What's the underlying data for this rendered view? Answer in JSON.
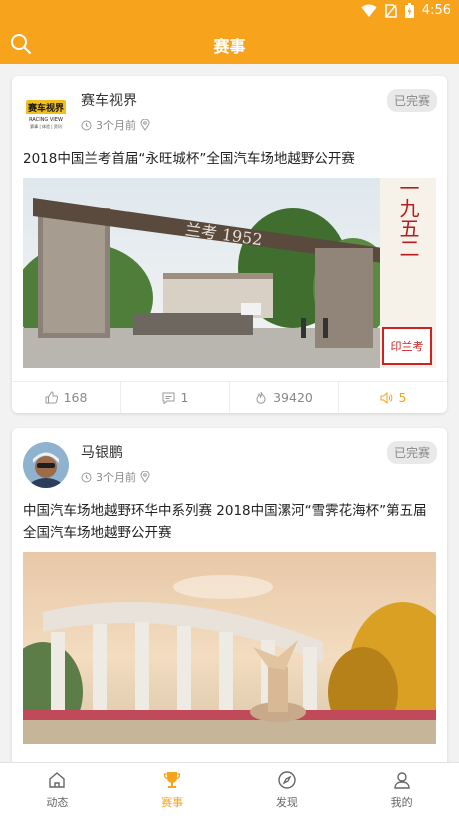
{
  "status_bar": {
    "time": "4:56"
  },
  "header": {
    "title": "赛事"
  },
  "theme": {
    "accent": "#f7a31c"
  },
  "feed": [
    {
      "author": "赛车视界",
      "avatar_text": "赛车视界",
      "avatar_sub": "RACING VIEW",
      "avatar_tag": "赛事 | 体验 | 资讯",
      "time": "3个月前",
      "status": "已完赛",
      "headline": "2018中国兰考首届“永旺城杯”全国汽车场地越野公开赛",
      "image_caption": "兰考 1952",
      "image_side": "蘭考一九五二",
      "image_seal": "印兰考",
      "stats": {
        "likes": "168",
        "comments": "1",
        "views": "39420",
        "shares": "5"
      }
    },
    {
      "author": "马银鹏",
      "time": "3个月前",
      "status": "已完赛",
      "headline": "中国汽车场地越野环华中系列赛 2018中国漯河“雪霁花海杯”第五届全国汽车场地越野公开赛"
    }
  ],
  "tabs": [
    {
      "label": "动态",
      "icon": "home-icon"
    },
    {
      "label": "赛事",
      "icon": "trophy-icon"
    },
    {
      "label": "发现",
      "icon": "compass-icon"
    },
    {
      "label": "我的",
      "icon": "user-icon"
    }
  ]
}
